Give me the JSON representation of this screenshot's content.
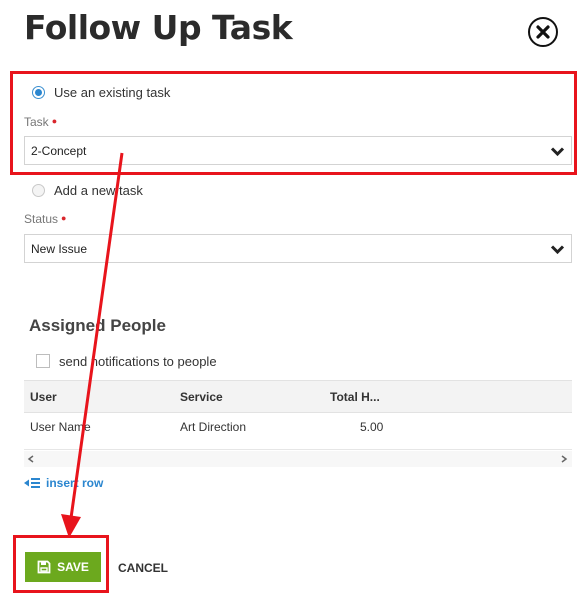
{
  "dialog": {
    "title": "Follow Up Task"
  },
  "options": {
    "existing_label": "Use an existing task",
    "new_label": "Add a new task"
  },
  "task_field": {
    "label": "Task",
    "value": "2-Concept"
  },
  "status_field": {
    "label": "Status",
    "value": "New Issue"
  },
  "assigned": {
    "title": "Assigned People",
    "notify_label": "send notifications to people",
    "columns": [
      "User",
      "Service",
      "Total H..."
    ],
    "rows": [
      {
        "user": "User Name",
        "service": "Art Direction",
        "total": "5.00"
      }
    ],
    "insert_row_label": "insert row"
  },
  "footer": {
    "save_label": "SAVE",
    "cancel_label": "CANCEL"
  },
  "colors": {
    "annotation": "#e8141c",
    "accent": "#2b86cf",
    "save": "#6ca91e"
  },
  "icons": [
    "close-icon",
    "chevron-down-icon",
    "save-icon",
    "insert-row-icon",
    "scroll-left-icon",
    "scroll-right-icon"
  ]
}
